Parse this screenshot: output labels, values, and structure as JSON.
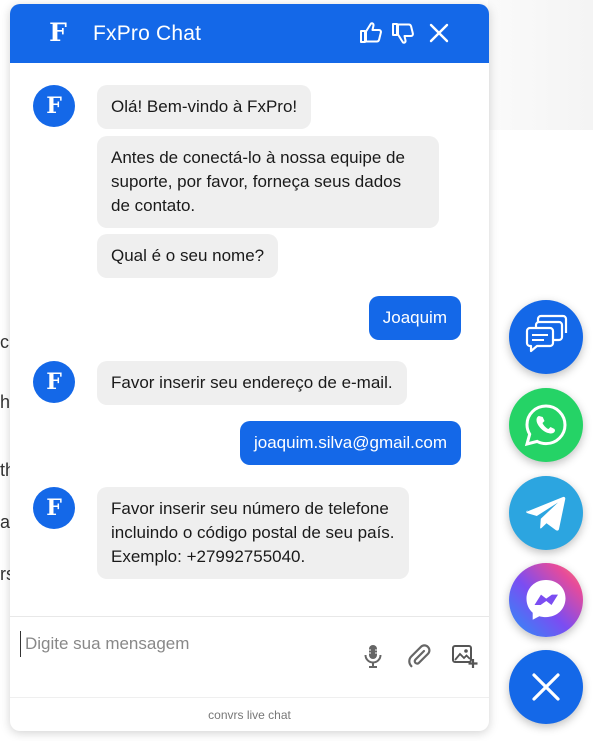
{
  "header": {
    "logo_letter": "F",
    "title": "FxPro Chat"
  },
  "messages": [
    {
      "from": "agent",
      "avatar": "F",
      "text": "Olá! Bem-vindo à FxPro!"
    },
    {
      "from": "agent",
      "text_lines": [
        "Antes de conectá-lo à nossa equipe de",
        "suporte, por favor, forneça seus dados",
        "de contato."
      ]
    },
    {
      "from": "agent",
      "text": "Qual é o seu nome?"
    },
    {
      "from": "user",
      "text": "Joaquim"
    },
    {
      "from": "agent",
      "avatar": "F",
      "text": "Favor inserir seu endereço de e-mail."
    },
    {
      "from": "user",
      "text": "joaquim.silva@gmail.com"
    },
    {
      "from": "agent",
      "avatar": "F",
      "text_lines": [
        "Favor inserir seu número de telefone",
        "incluindo o código postal de seu país.",
        "Exemplo: +27992755040."
      ]
    }
  ],
  "composer": {
    "placeholder": "Digite sua mensagem",
    "value": ""
  },
  "footer": {
    "brand": "convrs live chat"
  },
  "icons": {
    "header": [
      "thumbs-up-icon",
      "thumbs-down-icon",
      "close-icon"
    ],
    "composer": [
      "microphone-icon",
      "paperclip-icon",
      "image-add-icon"
    ],
    "launchers": [
      "chat-bubbles-icon",
      "whatsapp-icon",
      "telegram-icon",
      "messenger-icon",
      "close-icon"
    ]
  },
  "colors": {
    "brand_blue": "#1468e8",
    "agent_bubble": "#efefef",
    "whatsapp": "#25d366",
    "telegram": "#2ca5e0"
  },
  "background_fragments": [
    "c",
    "h",
    "th",
    "a",
    "rs"
  ]
}
